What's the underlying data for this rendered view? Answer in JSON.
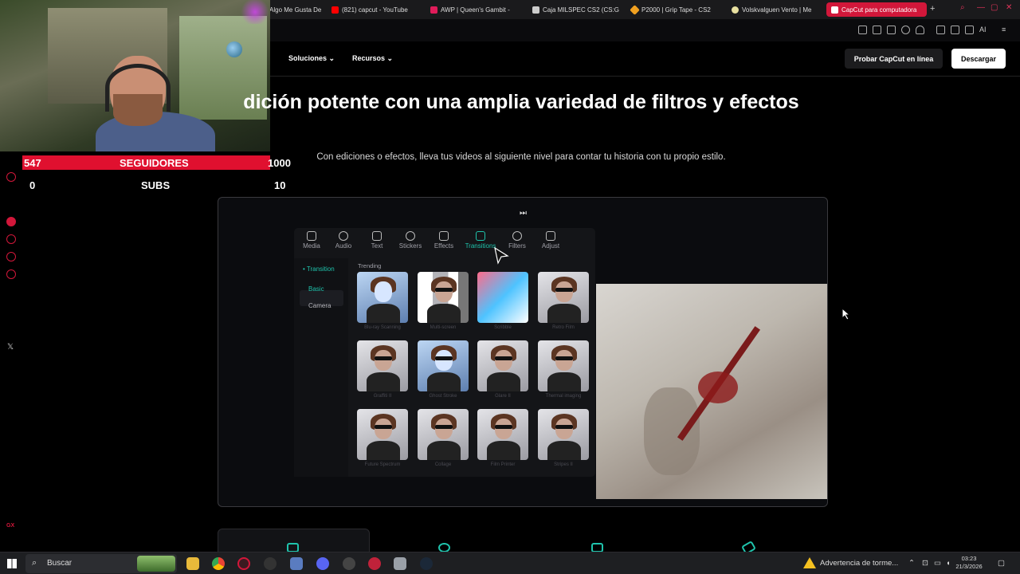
{
  "browser": {
    "tabs": [
      {
        "label": "Algo Me Gusta De",
        "icon": "opera-icon",
        "color": "#2a2a2a"
      },
      {
        "label": "(821) capcut - YouTube",
        "icon": "youtube-icon",
        "color": "#ff0000"
      },
      {
        "label": "AWP | Queen's Gambit -",
        "icon": "steam-market-icon",
        "color": "#e01c5a"
      },
      {
        "label": "Caja MILSPEC CS2 (CS:G",
        "icon": "box-icon",
        "color": "#cccccc"
      },
      {
        "label": "P2000 | Grip Tape - CS2",
        "icon": "diamond-icon",
        "color": "#f0a020"
      },
      {
        "label": "Volskvalguen Vento | Me",
        "icon": "car-icon",
        "color": "#e8e0a0"
      },
      {
        "label": "CapCut para computadora",
        "icon": "capcut-icon",
        "color": "#ffffff",
        "active": true
      }
    ],
    "new_tab": "+",
    "ai_label": "AI"
  },
  "stream": {
    "followers_current": "547",
    "followers_label": "SEGUIDORES",
    "followers_goal": "1000",
    "subs_current": "0",
    "subs_label": "SUBS",
    "subs_goal": "10"
  },
  "page": {
    "nav": {
      "items": [
        "Soluciones",
        "Recursos"
      ],
      "try_button": "Probar CapCut en línea",
      "download_button": "Descargar"
    },
    "headline": "dición potente con una amplia variedad de filtros y efectos",
    "subheadline": "Con ediciones o efectos, lleva tus videos al siguiente nivel para contar tu historia con tu propio estilo."
  },
  "editor": {
    "tabs": [
      {
        "label": "Media",
        "icon": "media-icon"
      },
      {
        "label": "Audio",
        "icon": "audio-icon"
      },
      {
        "label": "Text",
        "icon": "text-icon"
      },
      {
        "label": "Stickers",
        "icon": "sticker-icon"
      },
      {
        "label": "Effects",
        "icon": "effects-icon"
      },
      {
        "label": "Transitions",
        "icon": "transitions-icon",
        "selected": true
      },
      {
        "label": "Filters",
        "icon": "filters-icon"
      },
      {
        "label": "Adjust",
        "icon": "adjust-icon"
      }
    ],
    "sidebar": [
      "• Transition",
      "Basic",
      "Camera"
    ],
    "section_label": "Trending",
    "thumbnails": [
      "Blu-ray Scanning",
      "Multi-screen",
      "Scribble",
      "Retro Film",
      "Graffiti II",
      "Ghost Stroke",
      "Glare II",
      "Thermal imaging",
      "Future Spectrum",
      "Collage",
      "Film Printer",
      "Stripes II"
    ]
  },
  "taskbar": {
    "search_placeholder": "Buscar",
    "weather_alert": "Advertencia de torme...",
    "time": "03:23",
    "date": "21/3/2026"
  },
  "colors": {
    "accent": "#1fc3ac",
    "opera_red": "#d2173a",
    "counter_bar": "#e0102f"
  }
}
